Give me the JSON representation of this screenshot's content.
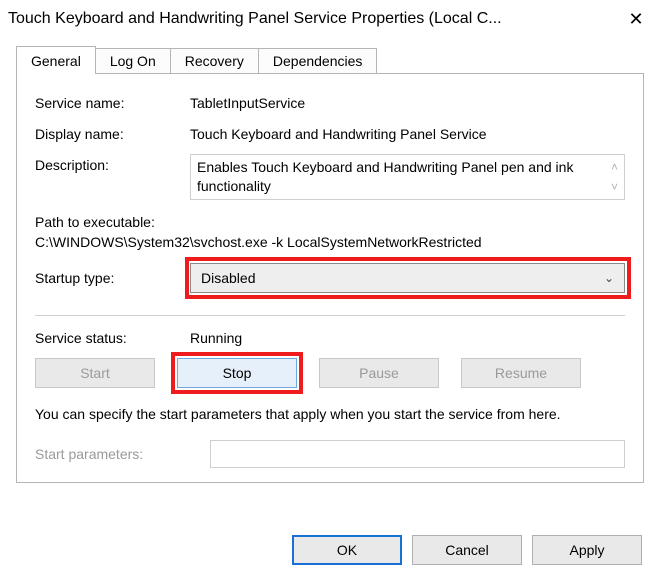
{
  "title": "Touch Keyboard and Handwriting Panel Service Properties (Local C...",
  "tabs": [
    "General",
    "Log On",
    "Recovery",
    "Dependencies"
  ],
  "labels": {
    "service_name": "Service name:",
    "display_name": "Display name:",
    "description": "Description:",
    "path_label": "Path to executable:",
    "startup_type": "Startup type:",
    "service_status": "Service status:",
    "start_parameters": "Start parameters:"
  },
  "values": {
    "service_name": "TabletInputService",
    "display_name": "Touch Keyboard and Handwriting Panel Service",
    "description": "Enables Touch Keyboard and Handwriting Panel pen and ink functionality",
    "path": "C:\\WINDOWS\\System32\\svchost.exe -k LocalSystemNetworkRestricted",
    "startup_type": "Disabled",
    "service_status": "Running"
  },
  "service_buttons": {
    "start": "Start",
    "stop": "Stop",
    "pause": "Pause",
    "resume": "Resume"
  },
  "note": "You can specify the start parameters that apply when you start the service from here.",
  "dialog_buttons": {
    "ok": "OK",
    "cancel": "Cancel",
    "apply": "Apply"
  }
}
